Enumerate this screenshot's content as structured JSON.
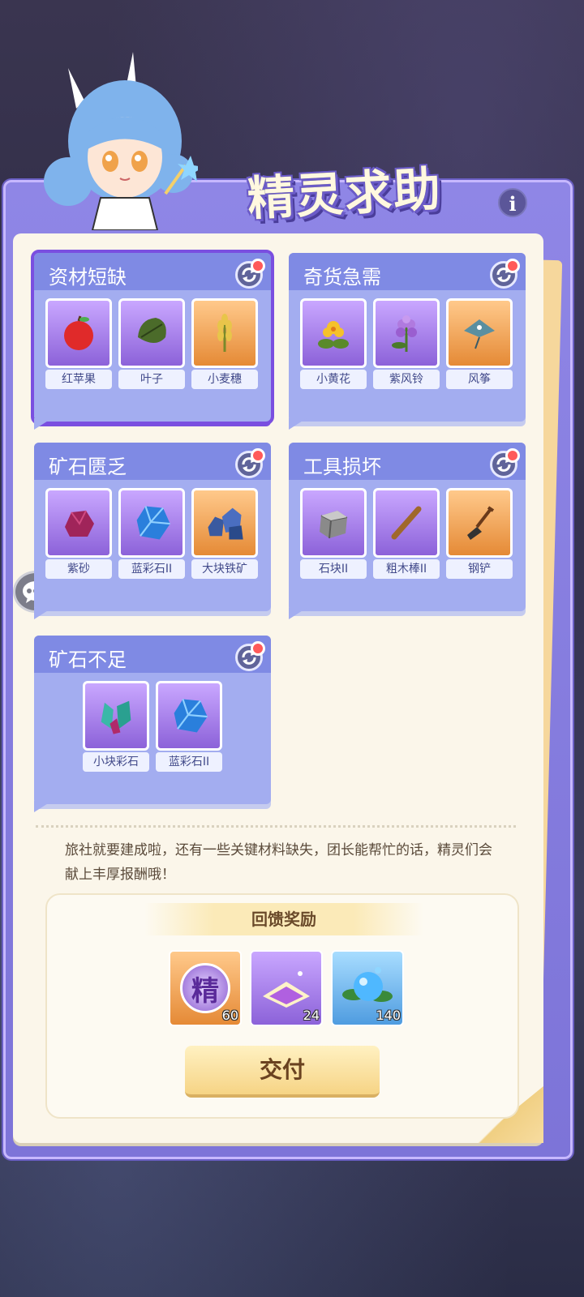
{
  "header": {
    "title": "精灵求助",
    "info_label": "i"
  },
  "cards": [
    {
      "title": "资材短缺",
      "selected": true,
      "items": [
        {
          "label": "红苹果",
          "icon": "apple-icon",
          "bg": "purple"
        },
        {
          "label": "叶子",
          "icon": "leaf-icon",
          "bg": "purple"
        },
        {
          "label": "小麦穗",
          "icon": "wheat-icon",
          "bg": "orange"
        }
      ]
    },
    {
      "title": "奇货急需",
      "selected": false,
      "items": [
        {
          "label": "小黄花",
          "icon": "yellow-flower-icon",
          "bg": "purple"
        },
        {
          "label": "紫风铃",
          "icon": "purple-bellflower-icon",
          "bg": "purple"
        },
        {
          "label": "风筝",
          "icon": "kite-icon",
          "bg": "orange"
        }
      ]
    },
    {
      "title": "矿石匮乏",
      "selected": false,
      "items": [
        {
          "label": "紫砂",
          "icon": "purple-sand-icon",
          "bg": "purple"
        },
        {
          "label": "蓝彩石II",
          "icon": "blue-gem-icon",
          "bg": "purple"
        },
        {
          "label": "大块铁矿",
          "icon": "iron-ore-icon",
          "bg": "orange"
        }
      ]
    },
    {
      "title": "工具损坏",
      "selected": false,
      "items": [
        {
          "label": "石块II",
          "icon": "stone-block-icon",
          "bg": "purple"
        },
        {
          "label": "粗木棒II",
          "icon": "wooden-stick-icon",
          "bg": "purple"
        },
        {
          "label": "钢铲",
          "icon": "steel-shovel-icon",
          "bg": "orange"
        }
      ]
    },
    {
      "title": "矿石不足",
      "selected": false,
      "items": [
        {
          "label": "小块彩石",
          "icon": "small-crystal-icon",
          "bg": "purple"
        },
        {
          "label": "蓝彩石II",
          "icon": "blue-gem-icon",
          "bg": "purple"
        }
      ]
    }
  ],
  "description": "旅社就要建成啦，还有一些关键材料缺失，团长能帮忙的话，精灵们会献上丰厚报酬哦！",
  "rewards": {
    "title": "回馈奖励",
    "items": [
      {
        "icon": "spirit-token-icon",
        "glyph": "精",
        "count": "60"
      },
      {
        "icon": "purple-sand-pile-icon",
        "count": "24"
      },
      {
        "icon": "water-orb-icon",
        "count": "140"
      }
    ]
  },
  "deliver_label": "交付",
  "colors": {
    "frame": "#8f86e6",
    "card": "#a3adf0",
    "card_header": "#7f8ae4",
    "paper": "#fbf6ea",
    "badge": "#ff5a5a"
  }
}
